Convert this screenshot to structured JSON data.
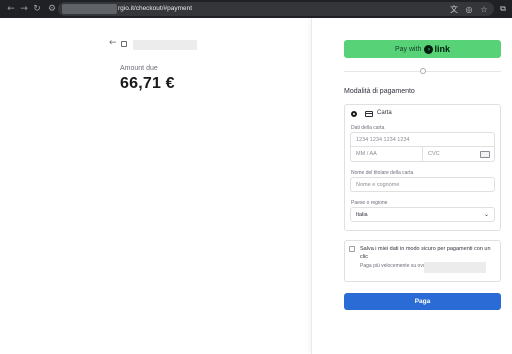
{
  "browser": {
    "url": "rgio.it/checkout/#payment",
    "icons": {
      "back": "arrow-left-icon",
      "forward": "arrow-right-icon",
      "reload": "reload-icon",
      "site_info": "site-info-icon",
      "translate": "translate-icon",
      "tracking": "eye-off-icon",
      "bookmark": "star-icon",
      "extensions": "extensions-icon"
    }
  },
  "summary": {
    "amount_label": "Amount due",
    "amount_value": "66,71 €"
  },
  "link": {
    "pay_with": "Pay with",
    "logo_text": "link",
    "color": "#57d277"
  },
  "payment": {
    "section_title": "Modalità di pagamento",
    "method_label": "Carta",
    "card_label": "Dati della carta",
    "card_placeholder": "1234 1234 1234 1234",
    "expiry_placeholder": "MM / AA",
    "cvc_placeholder": "CVC",
    "name_label": "Nome del titolare della carta",
    "name_placeholder": "Nome e cognome",
    "country_label": "Paese o regione",
    "country_value": "Italia"
  },
  "save": {
    "title": "Salva i miei dati in modo sicuro per pagamenti con un clic",
    "desc": "Paga più velocemente su                         ovunque sia usato Link."
  },
  "pay_button": {
    "label": "Paga",
    "color": "#2a6bd6"
  }
}
